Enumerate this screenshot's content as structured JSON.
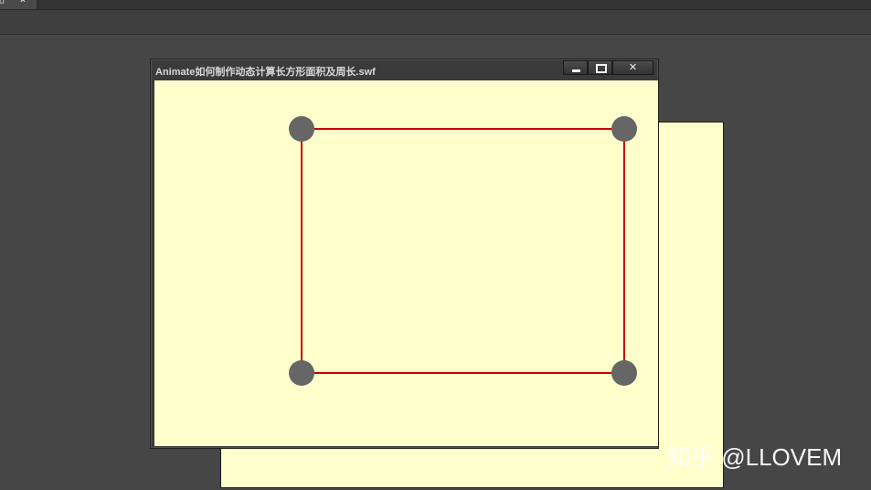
{
  "app": {
    "document_tab": {
      "label": "ld",
      "close_glyph": "×"
    }
  },
  "swf_window": {
    "title": "Animate如何制作动态计算长方形面积及周长.swf",
    "buttons": {
      "minimize_icon": "minimize-icon",
      "maximize_icon": "maximize-icon",
      "close_glyph": "✕"
    }
  },
  "stage": {
    "background_color": "#ffffcc",
    "rectangle_color": "#cc0000",
    "handle_color": "#666666",
    "handles": [
      "top-left",
      "top-right",
      "bottom-left",
      "bottom-right"
    ]
  },
  "watermark": {
    "text": "知乎 @LLOVEM"
  }
}
